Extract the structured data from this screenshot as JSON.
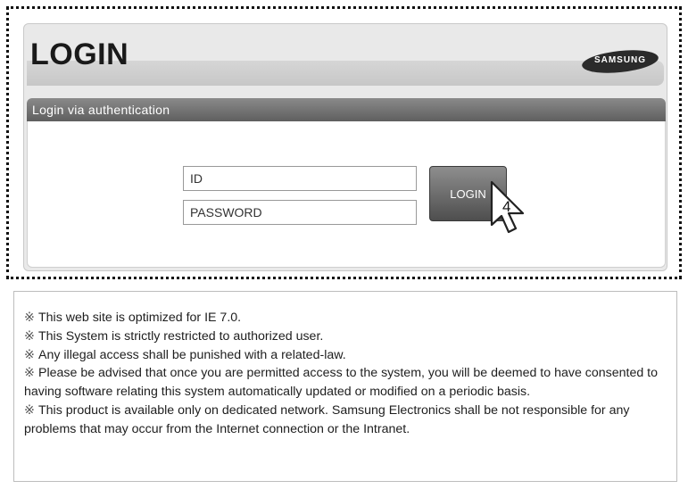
{
  "login": {
    "title": "LOGIN",
    "brand": "SAMSUNG",
    "section_title": "Login via authentication",
    "id_placeholder": "ID",
    "password_placeholder": "PASSWORD",
    "button_label": "LOGIN",
    "cursor_step": "4"
  },
  "notices": {
    "mark": "※",
    "lines": [
      "This web site is optimized for IE 7.0.",
      "This System is strictly restricted to authorized user.",
      "Any illegal access shall be punished with a related-law.",
      "Please be advised that once you are permitted access to the system, you will be deemed to have consented to having software relating this system automatically updated or modified on a periodic basis.",
      "This product is available only on dedicated network. Samsung Electronics shall be not responsible for any problems that may occur from the Internet connection or the Intranet."
    ]
  }
}
